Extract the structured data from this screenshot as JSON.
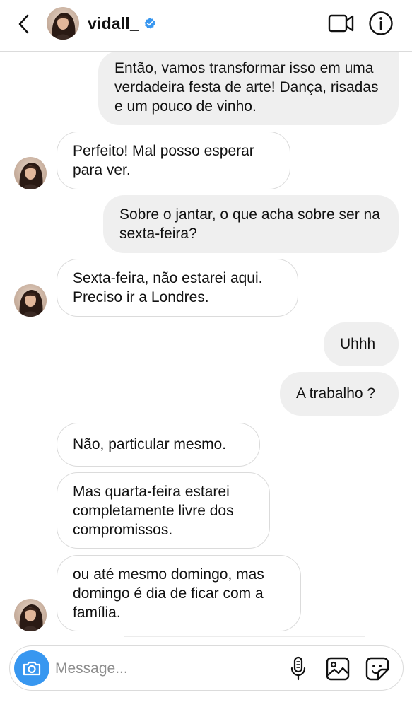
{
  "header": {
    "username": "vidall_",
    "verified": true,
    "back_icon": "chevron-left-icon",
    "video_icon": "video-camera-icon",
    "info_icon": "info-icon",
    "verified_color": "#3897f0"
  },
  "messages": [
    {
      "direction": "out",
      "text": "Então, vamos transformar isso em uma verdadeira festa de arte! Dança, risadas e um pouco de vinho.",
      "avatar": false
    },
    {
      "direction": "in",
      "text": "Perfeito! Mal posso esperar para ver.",
      "avatar": true
    },
    {
      "direction": "out",
      "text": "Sobre o jantar, o que acha sobre ser na sexta-feira?",
      "avatar": false
    },
    {
      "direction": "in",
      "text": "Sexta-feira, não estarei aqui. Preciso ir a Londres.",
      "avatar": true
    },
    {
      "direction": "out",
      "text": "Uhhh",
      "avatar": false
    },
    {
      "direction": "out",
      "text": "A trabalho ?",
      "avatar": false
    },
    {
      "direction": "in",
      "text": "Não, particular mesmo.",
      "avatar": false
    },
    {
      "direction": "in",
      "text": "Mas quarta-feira estarei completamente livre dos compromissos.",
      "avatar": false
    },
    {
      "direction": "in",
      "text": "ou até mesmo domingo, mas domingo é dia de ficar com a família.",
      "avatar": true
    }
  ],
  "composer": {
    "placeholder": "Message...",
    "value": "",
    "camera_icon": "camera-icon",
    "mic_icon": "microphone-icon",
    "gallery_icon": "image-gallery-icon",
    "sticker_icon": "sticker-icon",
    "accent_color": "#3897f0"
  },
  "colors": {
    "outgoing_bubble": "#efefef",
    "incoming_border": "#dbdbdb",
    "text": "#111111",
    "placeholder": "#8e8e8e"
  }
}
